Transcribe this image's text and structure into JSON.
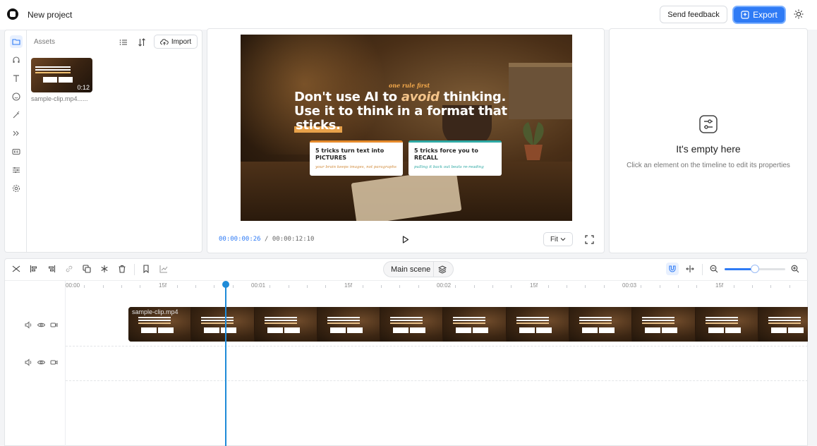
{
  "header": {
    "project_title": "New project",
    "feedback_label": "Send feedback",
    "export_label": "Export",
    "theme_icon": "sun-icon"
  },
  "sidebar": {
    "items": [
      {
        "icon": "folder-icon",
        "active": true
      },
      {
        "icon": "headphones-icon",
        "active": false
      },
      {
        "icon": "text-icon",
        "active": false
      },
      {
        "icon": "smiley-icon",
        "active": false
      },
      {
        "icon": "magic-wand-icon",
        "active": false
      },
      {
        "icon": "transitions-icon",
        "active": false
      },
      {
        "icon": "captions-icon",
        "active": false
      },
      {
        "icon": "adjust-icon",
        "active": false
      },
      {
        "icon": "settings-icon",
        "active": false
      }
    ]
  },
  "assets": {
    "label": "Assets",
    "import_label": "Import",
    "items": [
      {
        "name": "sample-clip.mp4......",
        "duration": "0:12"
      }
    ]
  },
  "preview": {
    "kicker": "one rule first",
    "headline_a": "Don't use AI to ",
    "headline_em": "avoid",
    "headline_b": " thinking.",
    "headline_line2": "Use it to think in a format that",
    "headline_line3": "sticks.",
    "card1_title": "5 tricks turn text into PICTURES",
    "card1_sub": "your brain keeps images, not paragraphs",
    "card2_title": "5 tricks force you to RECALL",
    "card2_sub": "pulling it back out beats re-reading",
    "time_current": "00:00:00:26",
    "time_separator": "/",
    "time_total": "00:00:12:10",
    "fit_label": "Fit"
  },
  "properties": {
    "title": "It's empty here",
    "subtitle": "Click an element on the timeline to edit its properties"
  },
  "timeline": {
    "scene_label": "Main scene",
    "zoom_level": 0.5,
    "ruler": [
      "00:00",
      "15f",
      "00:01",
      "15f",
      "00:02",
      "15f",
      "00:03",
      "15f"
    ],
    "clip_name": "sample-clip.mp4",
    "playhead_time": "00:00:00:26"
  },
  "colors": {
    "accent": "#2f7bf5",
    "playhead": "#1e8bd8"
  }
}
